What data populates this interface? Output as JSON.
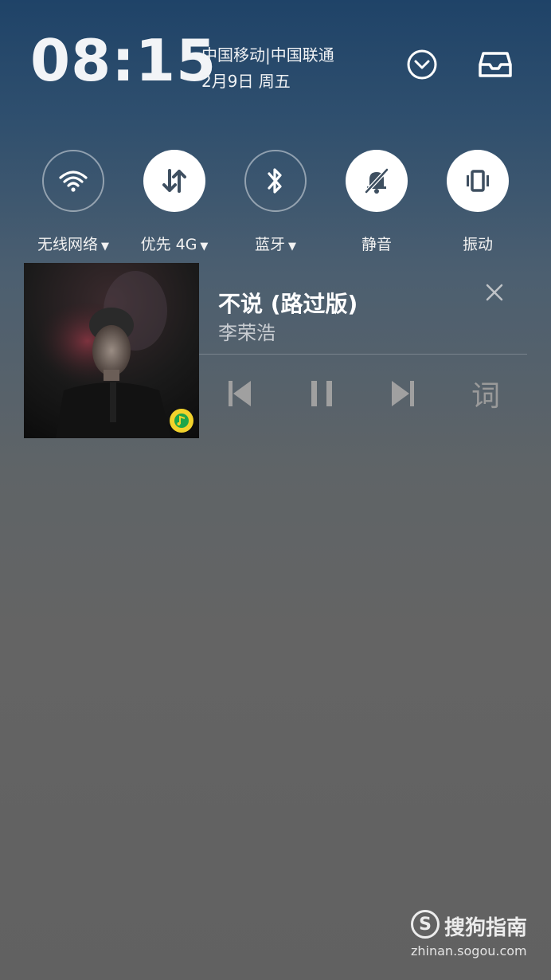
{
  "status": {
    "time": "08:15",
    "carrier": "中国移动|中国联通",
    "date": "2月9日 周五"
  },
  "header_icons": [
    "chevron-down-circle-icon",
    "inbox-tray-icon"
  ],
  "toggles": [
    {
      "label": "无线网络",
      "icon": "wifi-icon",
      "state": "off",
      "has_dropdown": true
    },
    {
      "label": "优先 4G",
      "icon": "mobile-data-arrows-icon",
      "state": "on",
      "has_dropdown": true
    },
    {
      "label": "蓝牙",
      "icon": "bluetooth-icon",
      "state": "off",
      "has_dropdown": true
    },
    {
      "label": "静音",
      "icon": "bell-muted-icon",
      "state": "on",
      "has_dropdown": false
    },
    {
      "label": "振动",
      "icon": "vibrate-icon",
      "state": "on",
      "has_dropdown": false
    }
  ],
  "dropdown_glyph": "▼",
  "music": {
    "title": "不说 (路过版)",
    "artist": "李荣浩",
    "controls": [
      "previous-icon",
      "pause-icon",
      "next-icon"
    ],
    "lyrics_label": "词",
    "close_glyph": "✕",
    "player_badge": "qq-music-icon"
  },
  "watermark": {
    "name": "搜狗指南",
    "url": "zhinan.sogou.com"
  },
  "colors": {
    "toggle_on_bg": "#ffffff",
    "toggle_icon_dark": "#3e4f60",
    "control_gray": "#a0a0a0",
    "badge_yellow": "#f2d22b",
    "badge_green": "#1fa64a"
  }
}
